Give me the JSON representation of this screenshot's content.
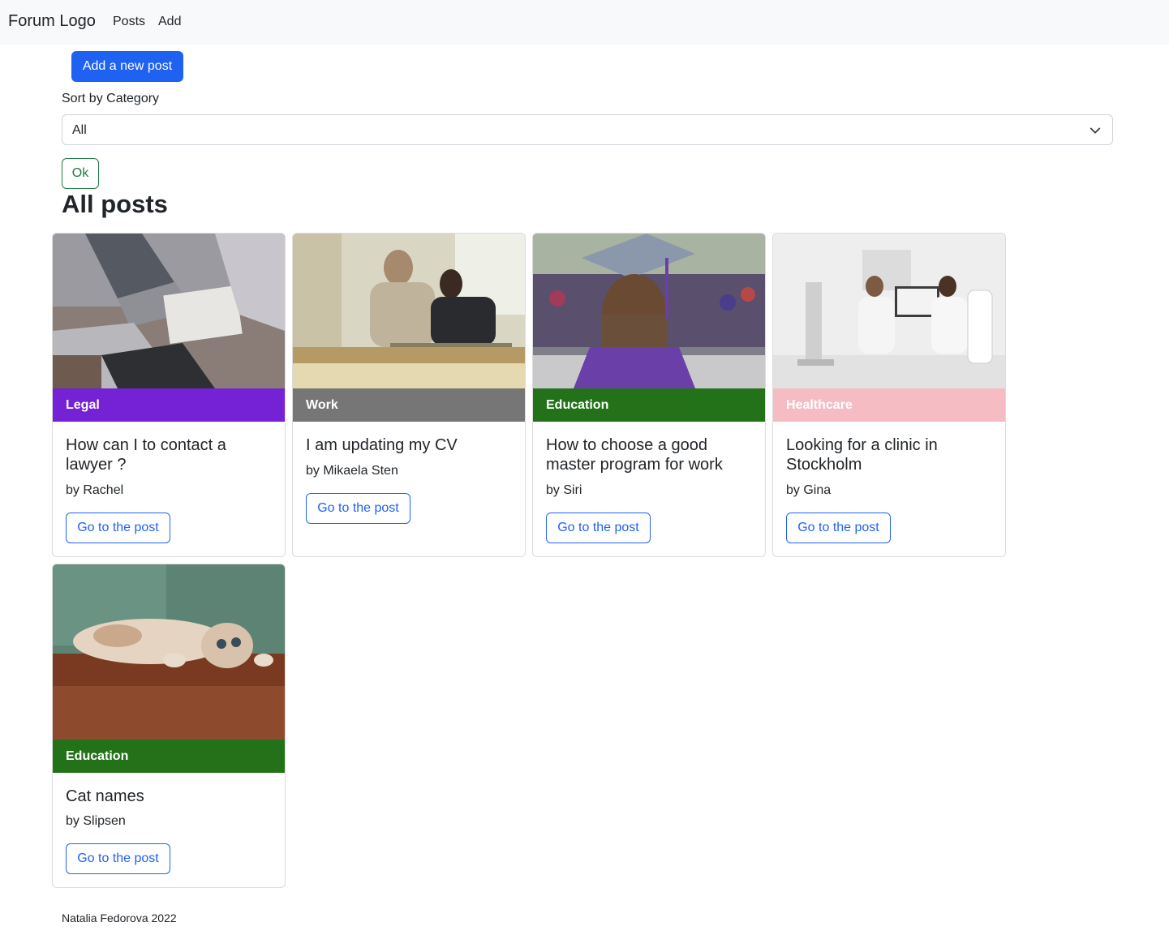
{
  "navbar": {
    "brand": "Forum Logo",
    "links": [
      "Posts",
      "Add"
    ]
  },
  "actions": {
    "add_post_label": "Add a new post"
  },
  "filter": {
    "label": "Sort by Category",
    "selected": "All",
    "ok_label": "Ok"
  },
  "heading": "All posts",
  "posts": [
    {
      "category": "Legal",
      "category_color": "#7521d6",
      "title": "How can I to contact a lawyer ?",
      "author": "by Rachel",
      "button": "Go to the post",
      "image_icon": "laptop-meeting-photo"
    },
    {
      "category": "Work",
      "category_color": "#767676",
      "title": "I am updating my CV",
      "author": "by Mikaela Sten",
      "button": "Go to the post",
      "image_icon": "interview-photo"
    },
    {
      "category": "Education",
      "category_color": "#23721a",
      "title": "How to choose a good master program for work",
      "author": "by Siri",
      "button": "Go to the post",
      "image_icon": "graduation-photo"
    },
    {
      "category": "Healthcare",
      "category_color": "#f5bcc4",
      "title": "Looking for a clinic in Stockholm",
      "author": "by Gina",
      "button": "Go to the post",
      "image_icon": "clinic-photo"
    },
    {
      "category": "Education",
      "category_color": "#23721a",
      "title": "Cat names",
      "author": "by Slipsen",
      "button": "Go to the post",
      "image_icon": "cat-photo"
    }
  ],
  "footer": "Natalia Fedorova 2022"
}
